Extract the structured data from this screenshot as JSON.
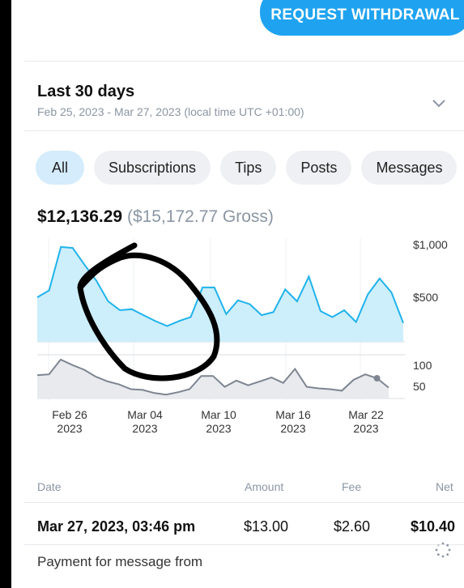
{
  "withdraw_button": {
    "label": "REQUEST WITHDRAWAL"
  },
  "period": {
    "title": "Last 30 days",
    "range": "Feb 25, 2023 - Mar 27, 2023 (local time UTC +01:00)"
  },
  "tabs": [
    {
      "label": "All",
      "active": true
    },
    {
      "label": "Subscriptions",
      "active": false
    },
    {
      "label": "Tips",
      "active": false
    },
    {
      "label": "Posts",
      "active": false
    },
    {
      "label": "Messages",
      "active": false
    }
  ],
  "totals": {
    "net": "$12,136.29",
    "gross": "($15,172.77 Gross)"
  },
  "chart_data": {
    "type": "area",
    "x_ticks": [
      {
        "day": "Feb 26",
        "year": "2023"
      },
      {
        "day": "Mar 04",
        "year": "2023"
      },
      {
        "day": "Mar 10",
        "year": "2023"
      },
      {
        "day": "Mar 16",
        "year": "2023"
      },
      {
        "day": "Mar 22",
        "year": "2023"
      }
    ],
    "upper_y_ticks": [
      "$1,000",
      "$500"
    ],
    "lower_y_ticks": [
      "100",
      "50"
    ],
    "earnings": [
      450,
      520,
      960,
      950,
      780,
      620,
      410,
      320,
      330,
      270,
      210,
      160,
      210,
      250,
      550,
      550,
      280,
      420,
      380,
      270,
      300,
      530,
      410,
      660,
      310,
      250,
      320,
      200,
      480,
      640,
      500,
      190
    ],
    "count": [
      60,
      62,
      100,
      86,
      74,
      56,
      44,
      36,
      24,
      22,
      14,
      10,
      16,
      24,
      58,
      58,
      30,
      46,
      34,
      44,
      54,
      40,
      76,
      30,
      26,
      24,
      20,
      48,
      62,
      52,
      28
    ],
    "colors": {
      "area_fill": "#cdeefb",
      "area_line": "#1fb3ec",
      "count_fill": "#e8eaee",
      "count_line": "#7d8590"
    },
    "annotation": "hand-drawn black circle"
  },
  "transactions": {
    "headers": {
      "date": "Date",
      "amount": "Amount",
      "fee": "Fee",
      "net": "Net"
    },
    "rows": [
      {
        "date": "Mar 27, 2023, 03:46 pm",
        "amount": "$13.00",
        "fee": "$2.60",
        "net": "$10.40",
        "description": "Payment for message from"
      }
    ]
  }
}
